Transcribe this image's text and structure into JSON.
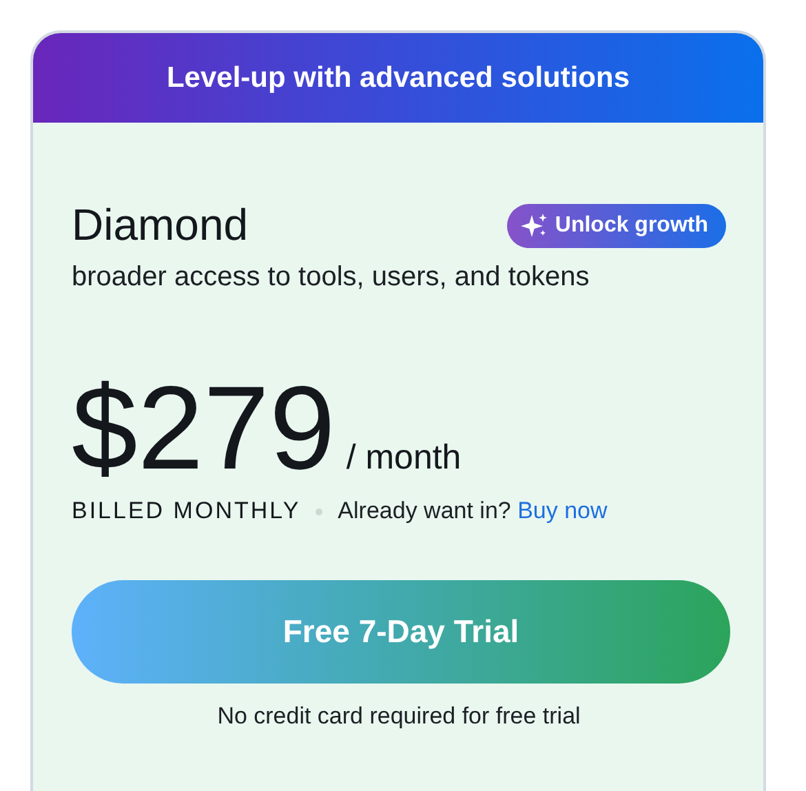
{
  "header": {
    "title": "Level-up with advanced solutions"
  },
  "plan": {
    "name": "Diamond",
    "badge": "Unlock growth",
    "description": "broader access to tools, users, and tokens"
  },
  "price": {
    "amount": "$279",
    "period": "/ month",
    "billing": "BILLED MONTHLY",
    "prompt": "Already want in?",
    "link": "Buy now"
  },
  "cta": {
    "label": "Free 7-Day Trial",
    "note": "No credit card required for free trial"
  }
}
